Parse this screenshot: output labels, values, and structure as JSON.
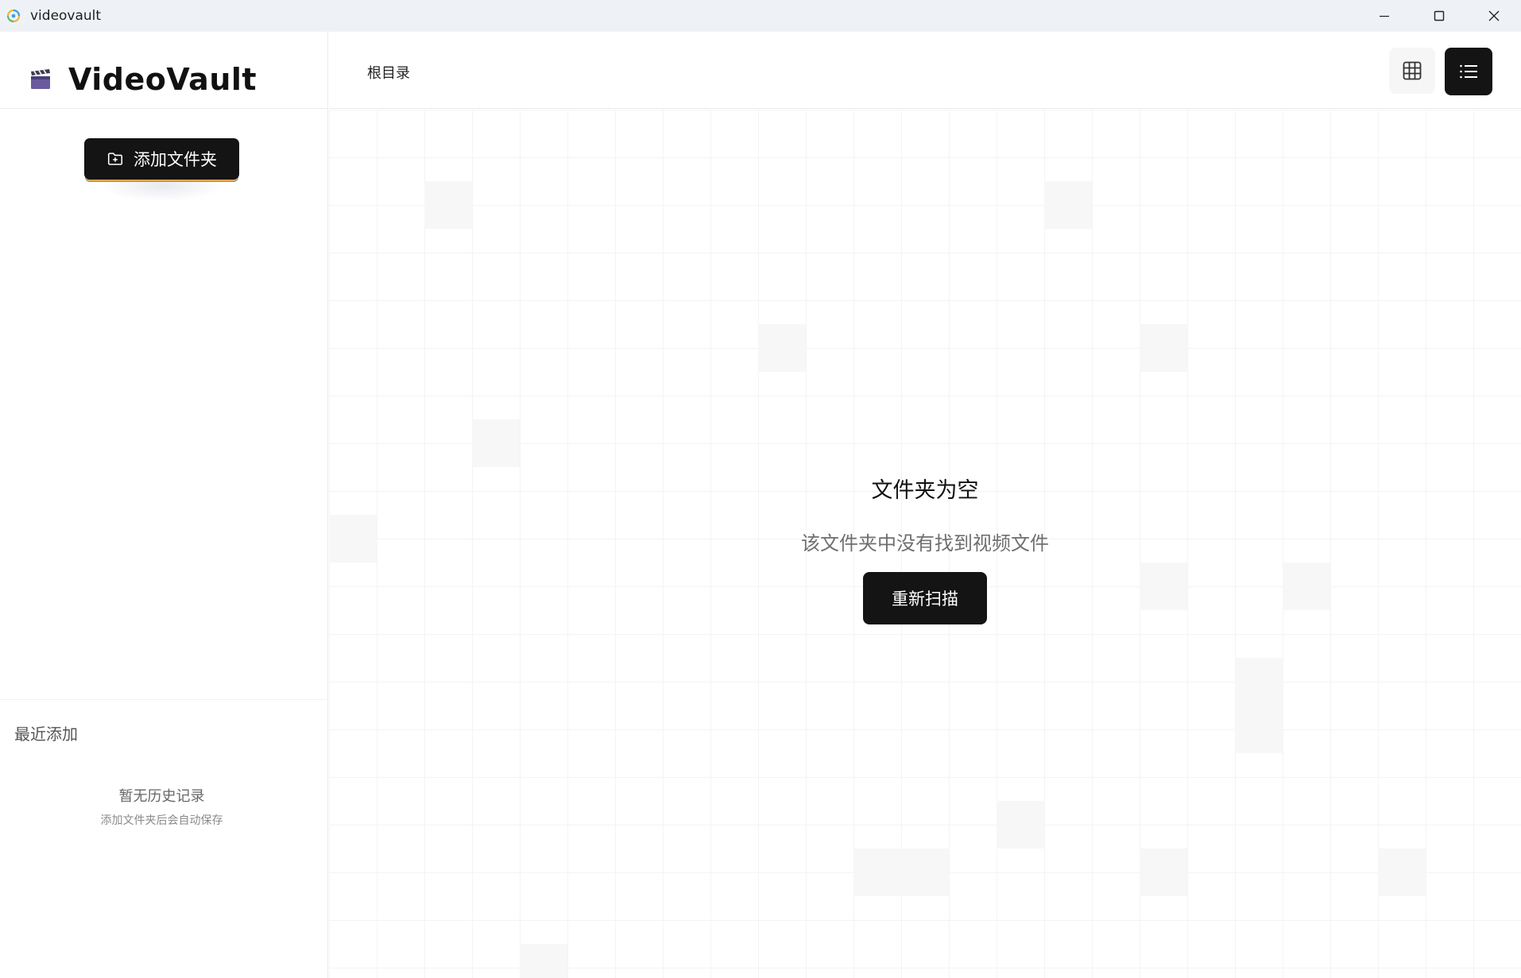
{
  "window": {
    "title": "videovault",
    "icon": "app-logo-icon",
    "controls": [
      "minimize-icon",
      "maximize-icon",
      "close-icon"
    ]
  },
  "sidebar": {
    "logo_text": "VideoVault",
    "logo_icon": "clapperboard-icon",
    "add_folder_label": "添加文件夹",
    "add_folder_icon": "folder-plus-icon",
    "recent_title": "最近添加",
    "empty_history": "暂无历史记录",
    "empty_history_hint": "添加文件夹后会自动保存"
  },
  "header": {
    "breadcrumb": "根目录",
    "view_modes": [
      {
        "name": "grid",
        "icon": "grid-icon",
        "active": false
      },
      {
        "name": "list",
        "icon": "list-icon",
        "active": true
      }
    ]
  },
  "main": {
    "empty_title": "文件夹为空",
    "empty_subtitle": "该文件夹中没有找到视频文件",
    "rescan_label": "重新扫描"
  },
  "colors": {
    "titlebar_bg": "#eef2f6",
    "primary_button": "#141414",
    "border": "#ececec"
  }
}
